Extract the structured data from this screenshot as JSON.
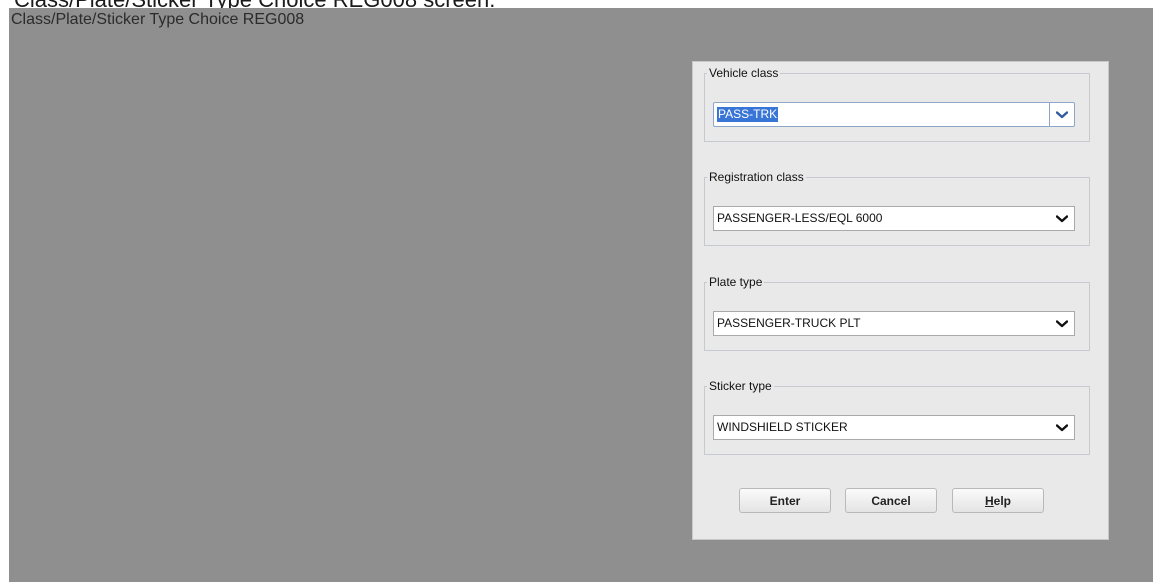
{
  "caption": "Class/Plate/Sticker Type Choice REG008 screen.",
  "screen": {
    "title": "Class/Plate/Sticker Type Choice REG008"
  },
  "dialog": {
    "vehicle_class": {
      "legend": "Vehicle class",
      "value": "PASS-TRK"
    },
    "registration_class": {
      "legend": "Registration class",
      "value": "PASSENGER-LESS/EQL 6000"
    },
    "plate_type": {
      "legend": "Plate type",
      "value": "PASSENGER-TRUCK PLT"
    },
    "sticker_type": {
      "legend": "Sticker type",
      "value": "WINDSHIELD STICKER"
    },
    "buttons": {
      "enter": "Enter",
      "cancel": "Cancel",
      "help_mnemonic": "H",
      "help_rest": "elp"
    }
  },
  "colors": {
    "screen_background": "#8f8f8f",
    "dialog_background": "#e9e9e9",
    "selection_highlight": "#3875d7",
    "focus_border": "#8ea6c9"
  },
  "icons": {
    "dropdown": "chevron-down-icon"
  }
}
